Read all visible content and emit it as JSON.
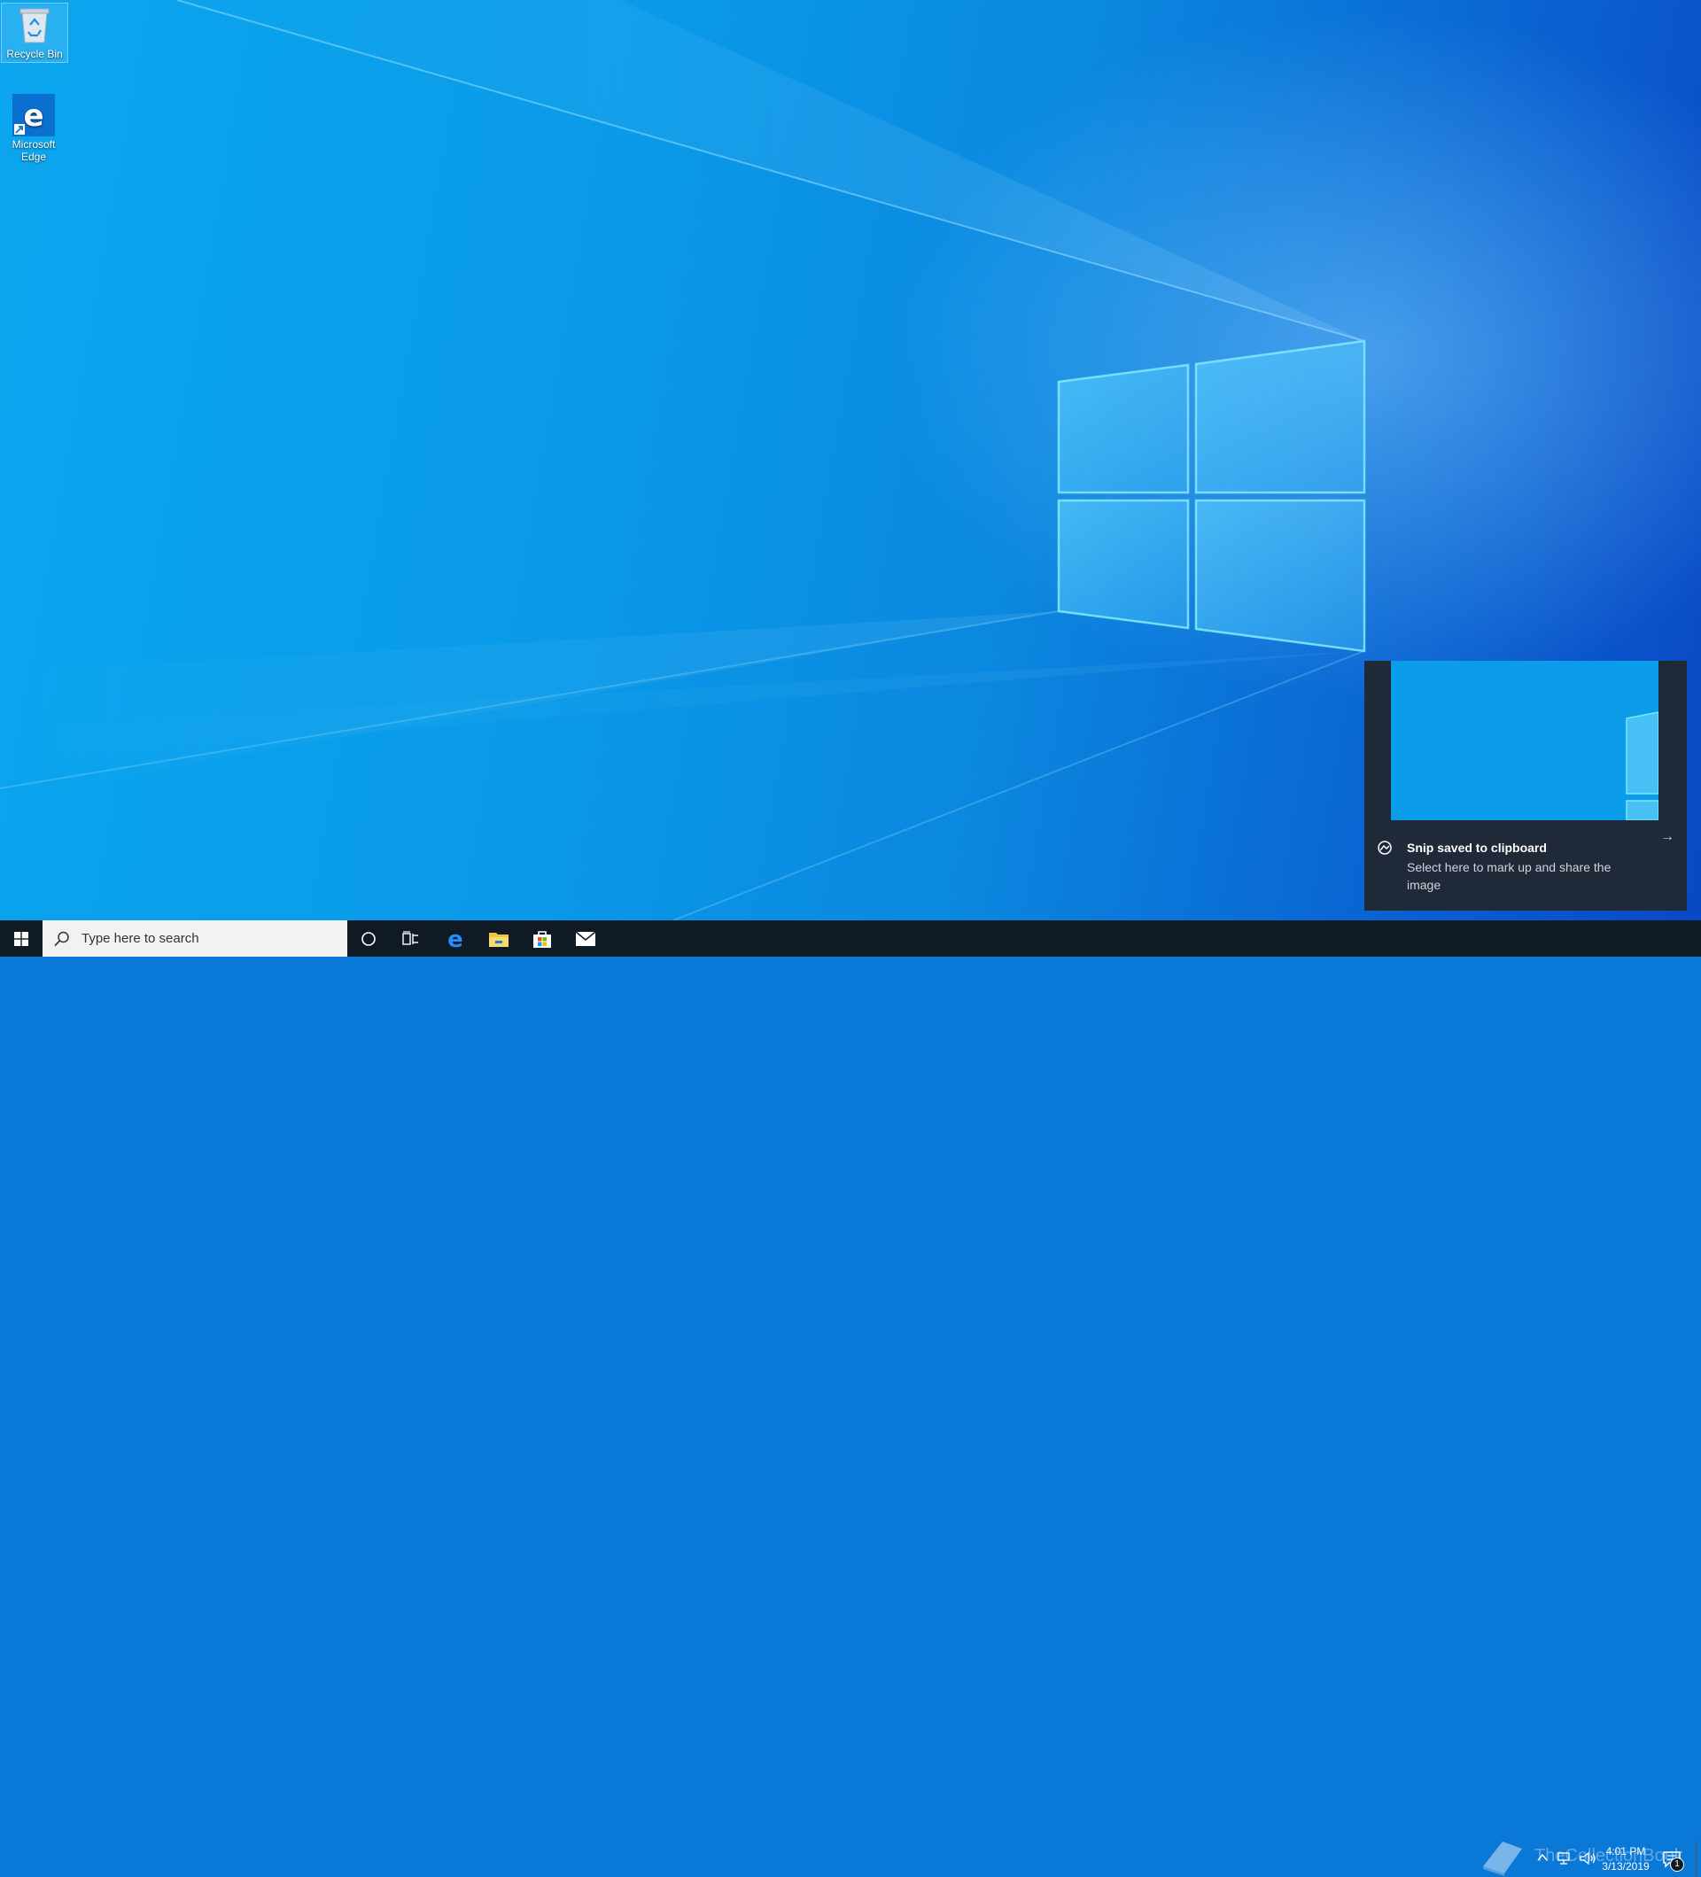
{
  "desktop": {
    "icons": [
      {
        "label": "Recycle Bin",
        "icon": "recycle-bin-icon"
      },
      {
        "label": "Microsoft Edge",
        "icon": "edge-icon"
      }
    ]
  },
  "notification": {
    "title": "Snip saved to clipboard",
    "body": "Select here to mark up and share the image",
    "icon": "snip-sketch-icon",
    "arrow": "→"
  },
  "taskbar": {
    "search_placeholder": "Type here to search",
    "pinned": [
      "cortana-icon",
      "task-view-icon",
      "edge-icon",
      "file-explorer-icon",
      "store-icon",
      "mail-icon"
    ],
    "watermark": "TheCollectionBook",
    "clock": {
      "time": "4:01 PM",
      "date": "3/13/2019"
    },
    "action_center_badge": "1"
  },
  "colors": {
    "accent": "#0a78d7",
    "taskbar": "#101a24",
    "toast": "#1f2938"
  }
}
